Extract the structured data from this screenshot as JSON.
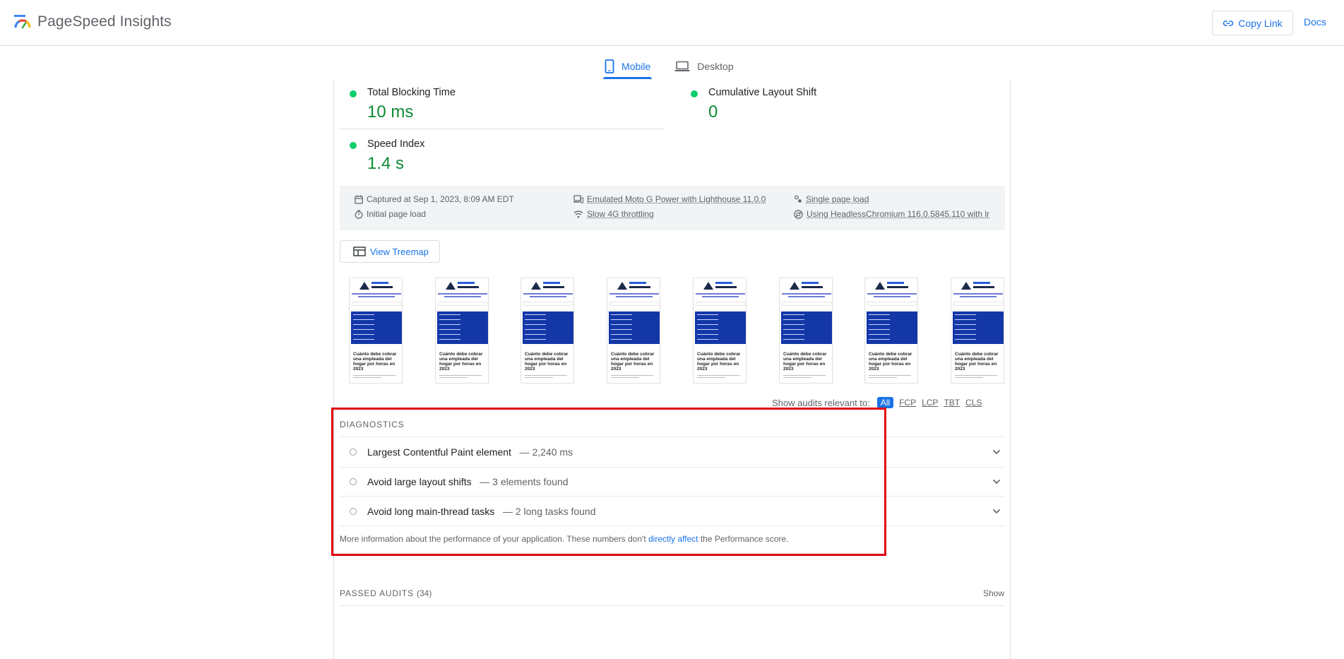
{
  "header": {
    "app_title": "PageSpeed Insights",
    "copy_link_label": "Copy Link",
    "docs_label": "Docs"
  },
  "tabs": [
    {
      "label": "Mobile",
      "active": true
    },
    {
      "label": "Desktop",
      "active": false
    }
  ],
  "metrics": {
    "tbt": {
      "label": "Total Blocking Time",
      "value": "10 ms",
      "status": "good"
    },
    "cls": {
      "label": "Cumulative Layout Shift",
      "value": "0",
      "status": "good"
    },
    "si": {
      "label": "Speed Index",
      "value": "1.4 s",
      "status": "good"
    }
  },
  "runtime_info": {
    "captured": "Captured at Sep 1, 2023, 8:09 AM EDT",
    "initial_load": "Initial page load",
    "device": "Emulated Moto G Power with Lighthouse 11.0.0",
    "throttling": "Slow 4G throttling",
    "session": "Single page load",
    "browser": "Using HeadlessChromium 116.0.5845.110 with lr"
  },
  "treemap_label": "View Treemap",
  "filmstrip": {
    "frame_headline": "Cuánto debe cobrar una empleada del hogar por horas en 2023",
    "frame_count": 8
  },
  "audit_filter": {
    "label": "Show audits relevant to:",
    "chips": [
      "All",
      "FCP",
      "LCP",
      "TBT",
      "CLS"
    ],
    "active": "All"
  },
  "diagnostics": {
    "title": "DIAGNOSTICS",
    "items": [
      {
        "title": "Largest Contentful Paint element",
        "detail": "2,240 ms"
      },
      {
        "title": "Avoid large layout shifts",
        "detail": "3 elements found"
      },
      {
        "title": "Avoid long main-thread tasks",
        "detail": "2 long tasks found"
      }
    ],
    "more_info_prefix": "More information about the performance of your application. These numbers don't",
    "more_info_link": "directly affect",
    "more_info_suffix": "the Performance score."
  },
  "passed_audits": {
    "title": "PASSED AUDITS",
    "count": "(34)",
    "show_label": "Show"
  },
  "colors": {
    "accent": "#1a73e8",
    "good": "#0cce6b",
    "good_text": "#0c8b35",
    "highlight": "#e0000f"
  }
}
